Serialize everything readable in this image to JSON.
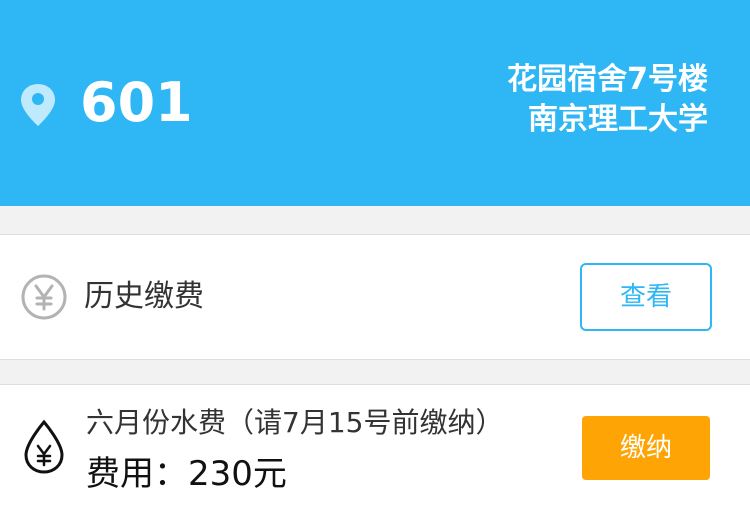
{
  "colors": {
    "header_bg": "#2eb6f5",
    "accent_blue": "#2eb6f5",
    "pay_orange": "#ffa405"
  },
  "header": {
    "icon": "location-pin-icon",
    "room_number": "601",
    "building": "花园宿舍7号楼",
    "school": "南京理工大学"
  },
  "history": {
    "icon": "yen-circle-icon",
    "label": "历史缴费",
    "button_label": "查看"
  },
  "bill": {
    "icon": "water-drop-yen-icon",
    "title": "六月份水费（请7月15号前缴纳）",
    "amount": "费用：230元",
    "button_label": "缴纳"
  }
}
